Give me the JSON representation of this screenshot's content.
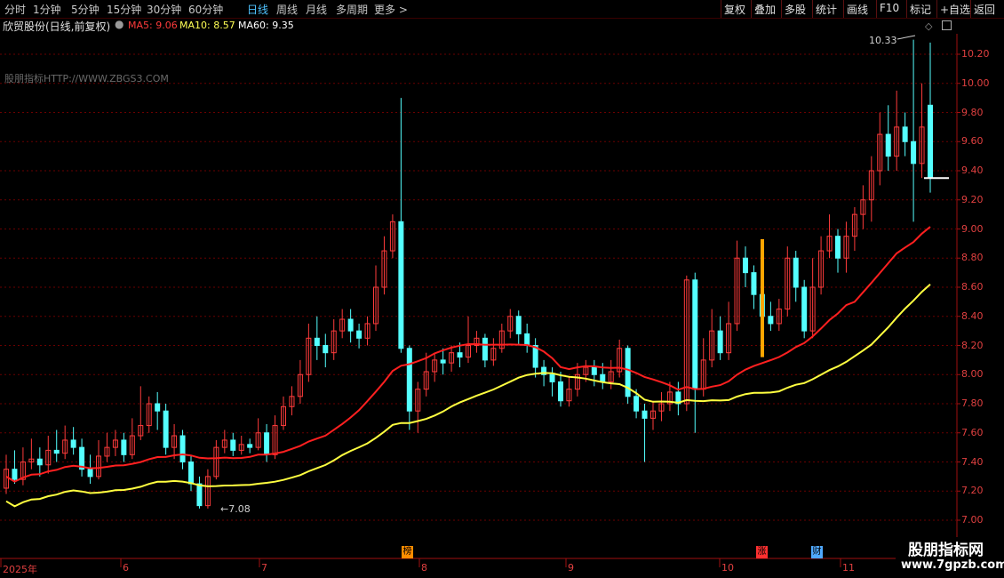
{
  "toolbar": {
    "left": [
      {
        "label": "分时",
        "active": false
      },
      {
        "label": "1分钟",
        "active": false
      },
      {
        "label": "5分钟",
        "active": false
      },
      {
        "label": "15分钟",
        "active": false
      },
      {
        "label": "30分钟",
        "active": false
      },
      {
        "label": "60分钟",
        "active": false
      },
      {
        "label": "日线",
        "active": true
      },
      {
        "label": "周线",
        "active": false
      },
      {
        "label": "月线",
        "active": false
      },
      {
        "label": "多周期",
        "active": false
      },
      {
        "label": "更多 >",
        "active": false
      }
    ],
    "right": [
      "复权",
      "叠加",
      "多股",
      "统计",
      "画线",
      "F10",
      "标记",
      "+自选",
      "返回"
    ]
  },
  "info": {
    "title": "欣贸股份(日线,前复权)",
    "ma5": "MA5: 9.06",
    "ma10": "MA10: 8.57",
    "ma60": "MA60: 9.35",
    "colors": {
      "ma5": "#ff3b3b",
      "ma10": "#ffff55",
      "ma60": "#ffffff"
    }
  },
  "watermark_site": "股朋指标HTTP://WWW.ZBGS3.COM",
  "watermark_box": {
    "line1": "股朋指标网",
    "line2": "www.7gpzb.com"
  },
  "annotations": {
    "high": "10.33",
    "low": "7.08"
  },
  "events": [
    {
      "label": "榜",
      "color": "#ff8c00"
    },
    {
      "label": "涨",
      "color": "#ff3030"
    },
    {
      "label": "财",
      "color": "#4fa8ff"
    }
  ],
  "chart_data": {
    "type": "candlestick",
    "y_ticks": [
      "10.20",
      "10.00",
      "9.80",
      "9.60",
      "9.40",
      "9.20",
      "9.00",
      "8.80",
      "8.60",
      "8.40",
      "8.20",
      "8.00",
      "7.80",
      "7.60",
      "7.40",
      "7.20",
      "7.00"
    ],
    "x_labels": [
      "2025年",
      "6",
      "7",
      "8",
      "9",
      "10",
      "11"
    ],
    "ylim": [
      6.98,
      10.35
    ],
    "colors": {
      "up": "#ff3b3b",
      "down": "#54ffff",
      "ma_red": "#ff2020",
      "ma_yellow": "#ffff40"
    },
    "candles": [
      [
        7.22,
        7.35,
        7.45,
        7.18
      ],
      [
        7.35,
        7.28,
        7.48,
        7.25
      ],
      [
        7.28,
        7.4,
        7.5,
        7.24
      ],
      [
        7.4,
        7.42,
        7.56,
        7.35
      ],
      [
        7.42,
        7.38,
        7.5,
        7.3
      ],
      [
        7.38,
        7.48,
        7.58,
        7.32
      ],
      [
        7.48,
        7.46,
        7.62,
        7.4
      ],
      [
        7.46,
        7.55,
        7.65,
        7.42
      ],
      [
        7.55,
        7.5,
        7.64,
        7.45
      ],
      [
        7.5,
        7.35,
        7.56,
        7.3
      ],
      [
        7.35,
        7.3,
        7.45,
        7.25
      ],
      [
        7.3,
        7.44,
        7.55,
        7.28
      ],
      [
        7.44,
        7.5,
        7.6,
        7.4
      ],
      [
        7.5,
        7.55,
        7.62,
        7.44
      ],
      [
        7.55,
        7.45,
        7.6,
        7.4
      ],
      [
        7.45,
        7.58,
        7.7,
        7.42
      ],
      [
        7.58,
        7.65,
        7.92,
        7.55
      ],
      [
        7.65,
        7.8,
        7.85,
        7.6
      ],
      [
        7.8,
        7.75,
        7.88,
        7.62
      ],
      [
        7.75,
        7.5,
        7.8,
        7.45
      ],
      [
        7.5,
        7.58,
        7.66,
        7.42
      ],
      [
        7.58,
        7.4,
        7.62,
        7.35
      ],
      [
        7.4,
        7.25,
        7.44,
        7.2
      ],
      [
        7.25,
        7.1,
        7.3,
        7.08
      ],
      [
        7.1,
        7.3,
        7.35,
        7.08
      ],
      [
        7.3,
        7.5,
        7.55,
        7.28
      ],
      [
        7.5,
        7.55,
        7.62,
        7.46
      ],
      [
        7.55,
        7.48,
        7.6,
        7.44
      ],
      [
        7.48,
        7.52,
        7.58,
        7.45
      ],
      [
        7.52,
        7.5,
        7.56,
        7.46
      ],
      [
        7.5,
        7.6,
        7.7,
        7.48
      ],
      [
        7.6,
        7.45,
        7.66,
        7.4
      ],
      [
        7.45,
        7.65,
        7.72,
        7.42
      ],
      [
        7.65,
        7.78,
        7.85,
        7.62
      ],
      [
        7.78,
        7.85,
        7.92,
        7.72
      ],
      [
        7.85,
        8.0,
        8.1,
        7.8
      ],
      [
        8.0,
        8.25,
        8.35,
        7.95
      ],
      [
        8.25,
        8.2,
        8.4,
        8.1
      ],
      [
        8.2,
        8.15,
        8.28,
        8.05
      ],
      [
        8.15,
        8.3,
        8.38,
        8.1
      ],
      [
        8.3,
        8.38,
        8.45,
        8.25
      ],
      [
        8.38,
        8.3,
        8.45,
        8.22
      ],
      [
        8.3,
        8.25,
        8.35,
        8.18
      ],
      [
        8.25,
        8.35,
        8.4,
        8.2
      ],
      [
        8.35,
        8.6,
        8.75,
        8.3
      ],
      [
        8.6,
        8.85,
        8.95,
        8.55
      ],
      [
        8.85,
        9.05,
        9.1,
        8.8
      ],
      [
        9.05,
        8.18,
        9.9,
        8.15
      ],
      [
        8.18,
        7.75,
        8.2,
        7.62
      ],
      [
        7.75,
        7.9,
        7.95,
        7.6
      ],
      [
        7.9,
        8.02,
        8.15,
        7.85
      ],
      [
        8.02,
        8.1,
        8.15,
        7.95
      ],
      [
        8.1,
        8.08,
        8.18,
        8.0
      ],
      [
        8.08,
        8.15,
        8.2,
        8.02
      ],
      [
        8.15,
        8.12,
        8.22,
        8.05
      ],
      [
        8.12,
        8.2,
        8.4,
        8.08
      ],
      [
        8.2,
        8.25,
        8.3,
        8.15
      ],
      [
        8.25,
        8.1,
        8.28,
        8.05
      ],
      [
        8.1,
        8.18,
        8.25,
        8.06
      ],
      [
        8.18,
        8.3,
        8.35,
        8.15
      ],
      [
        8.3,
        8.4,
        8.45,
        8.25
      ],
      [
        8.4,
        8.28,
        8.44,
        8.2
      ],
      [
        8.28,
        8.2,
        8.35,
        8.15
      ],
      [
        8.2,
        8.05,
        8.25,
        7.98
      ],
      [
        8.05,
        8.0,
        8.1,
        7.92
      ],
      [
        8.0,
        7.95,
        8.05,
        7.85
      ],
      [
        7.95,
        7.82,
        8.02,
        7.78
      ],
      [
        7.82,
        7.9,
        7.98,
        7.78
      ],
      [
        7.9,
        8.0,
        8.08,
        7.85
      ],
      [
        8.0,
        8.05,
        8.1,
        7.95
      ],
      [
        8.05,
        8.0,
        8.1,
        7.92
      ],
      [
        8.0,
        7.95,
        8.08,
        7.9
      ],
      [
        7.95,
        8.02,
        8.1,
        7.9
      ],
      [
        8.02,
        8.18,
        8.24,
        7.98
      ],
      [
        8.18,
        7.85,
        8.2,
        7.8
      ],
      [
        7.85,
        7.75,
        7.9,
        7.7
      ],
      [
        7.75,
        7.7,
        7.8,
        7.4
      ],
      [
        7.7,
        7.75,
        7.82,
        7.62
      ],
      [
        7.75,
        7.8,
        7.88,
        7.68
      ],
      [
        7.8,
        7.88,
        7.95,
        7.75
      ],
      [
        7.88,
        7.8,
        7.95,
        7.72
      ],
      [
        7.8,
        8.65,
        8.68,
        7.75
      ],
      [
        8.65,
        7.9,
        8.7,
        7.6
      ],
      [
        7.9,
        8.1,
        8.25,
        7.85
      ],
      [
        8.1,
        8.3,
        8.45,
        8.05
      ],
      [
        8.3,
        8.15,
        8.4,
        8.1
      ],
      [
        8.15,
        8.35,
        8.5,
        8.1
      ],
      [
        8.35,
        8.8,
        8.92,
        8.3
      ],
      [
        8.8,
        8.7,
        8.88,
        8.6
      ],
      [
        8.7,
        8.55,
        8.75,
        8.45
      ],
      [
        8.55,
        8.4,
        8.62,
        8.35
      ],
      [
        8.4,
        8.35,
        8.5,
        8.3
      ],
      [
        8.35,
        8.45,
        8.52,
        8.3
      ],
      [
        8.45,
        8.8,
        8.88,
        8.4
      ],
      [
        8.8,
        8.6,
        8.85,
        8.5
      ],
      [
        8.6,
        8.3,
        8.65,
        8.25
      ],
      [
        8.3,
        8.6,
        8.8,
        8.25
      ],
      [
        8.6,
        8.85,
        8.95,
        8.55
      ],
      [
        8.85,
        8.95,
        9.1,
        8.8
      ],
      [
        8.95,
        8.8,
        9.0,
        8.7
      ],
      [
        8.8,
        8.95,
        9.05,
        8.7
      ],
      [
        8.95,
        9.1,
        9.15,
        8.85
      ],
      [
        9.1,
        9.2,
        9.3,
        9.0
      ],
      [
        9.2,
        9.4,
        9.5,
        9.05
      ],
      [
        9.4,
        9.65,
        9.8,
        9.3
      ],
      [
        9.65,
        9.5,
        9.85,
        9.4
      ],
      [
        9.5,
        9.7,
        9.95,
        9.4
      ],
      [
        9.7,
        9.6,
        9.8,
        9.5
      ],
      [
        9.6,
        9.45,
        10.3,
        9.05
      ],
      [
        9.45,
        9.7,
        10.0,
        9.35
      ],
      [
        9.85,
        9.35,
        10.28,
        9.25
      ]
    ]
  }
}
